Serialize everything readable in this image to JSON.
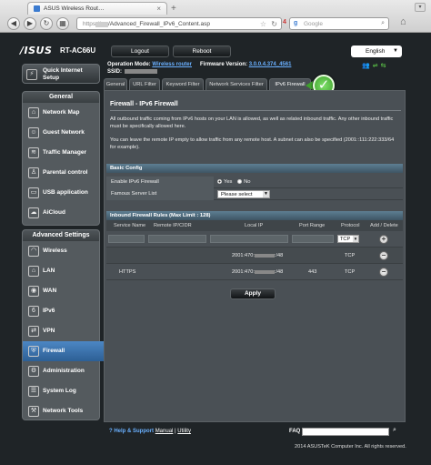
{
  "browser": {
    "tab_title": "ASUS Wireless Rout…",
    "url_scheme": "https://",
    "url_path": "/Advanced_Firewall_IPv6_Content.asp",
    "search_placeholder": "Google",
    "badge_count": "4"
  },
  "header": {
    "logo": "/ISUS",
    "model": "RT-AC66U",
    "logout": "Logout",
    "reboot": "Reboot",
    "language": "English"
  },
  "status": {
    "op_mode_label": "Operation Mode:",
    "op_mode_value": "Wireless router",
    "fw_label": "Firmware Version:",
    "fw_value": "3.0.0.4.374_4561",
    "ssid_label": "SSID:"
  },
  "sidebar": {
    "qis": "Quick Internet Setup",
    "general_title": "General",
    "general": [
      {
        "label": "Network Map",
        "icon": "network-map-icon",
        "glyph": "⌂"
      },
      {
        "label": "Guest Network",
        "icon": "guest-network-icon",
        "glyph": "☺"
      },
      {
        "label": "Traffic Manager",
        "icon": "traffic-manager-icon",
        "glyph": "≋"
      },
      {
        "label": "Parental control",
        "icon": "parental-control-icon",
        "glyph": "♙"
      },
      {
        "label": "USB application",
        "icon": "usb-application-icon",
        "glyph": "▭"
      },
      {
        "label": "AiCloud",
        "icon": "aicloud-icon",
        "glyph": "☁"
      }
    ],
    "advanced_title": "Advanced Settings",
    "advanced": [
      {
        "label": "Wireless",
        "icon": "wireless-icon",
        "glyph": "◠",
        "active": false
      },
      {
        "label": "LAN",
        "icon": "lan-icon",
        "glyph": "⌂",
        "active": false
      },
      {
        "label": "WAN",
        "icon": "wan-icon",
        "glyph": "◉",
        "active": false
      },
      {
        "label": "IPv6",
        "icon": "ipv6-icon",
        "glyph": "6",
        "active": false
      },
      {
        "label": "VPN",
        "icon": "vpn-icon",
        "glyph": "⇄",
        "active": false
      },
      {
        "label": "Firewall",
        "icon": "firewall-icon",
        "glyph": "⛨",
        "active": true
      },
      {
        "label": "Administration",
        "icon": "administration-icon",
        "glyph": "⚙",
        "active": false
      },
      {
        "label": "System Log",
        "icon": "system-log-icon",
        "glyph": "☰",
        "active": false
      },
      {
        "label": "Network Tools",
        "icon": "network-tools-icon",
        "glyph": "⚒",
        "active": false
      }
    ]
  },
  "tabs": [
    "General",
    "URL Filter",
    "Keyword Filter",
    "Network Services Filter",
    "IPv6 Firewall"
  ],
  "active_tab": "IPv6 Firewall",
  "panel": {
    "title": "Firewall - IPv6 Firewall",
    "desc1": "All outbound traffic coming from IPv6 hosts on your LAN is allowed, as well as related inbound traffic. Any other inbound traffic must be specifically allowed here.",
    "desc2": "You can leave the remote IP empty to allow traffic from any remote host. A subnet can also be specified (2001::111:222:333/64 for example).",
    "basic_config_title": "Basic Config",
    "enable_label": "Enable IPv6 Firewall",
    "yes": "Yes",
    "no": "No",
    "famous_label": "Famous Server List",
    "famous_value": "Please select",
    "rules_title": "Inbound Firewall Rules (Max Limit : 128)",
    "columns": [
      "Service Name",
      "Remote IP/CIDR",
      "Local IP",
      "Port Range",
      "Protocol",
      "Add / Delete"
    ],
    "new_protocol": "TCP",
    "rules": [
      {
        "service": "",
        "remote": "",
        "local_prefix": "2001:470:",
        "local_suffix": ":/48",
        "port": "",
        "protocol": "TCP"
      },
      {
        "service": "HTTPS",
        "remote": "",
        "local_prefix": "2001:470:",
        "local_suffix": ":/48",
        "port": "443",
        "protocol": "TCP"
      }
    ],
    "apply": "Apply"
  },
  "footer": {
    "help": "Help & Support",
    "manual": "Manual",
    "sep": " | ",
    "utility": "Utility",
    "faq": "FAQ",
    "copyright": "2014 ASUSTeK Computer Inc. All rights reserved."
  }
}
